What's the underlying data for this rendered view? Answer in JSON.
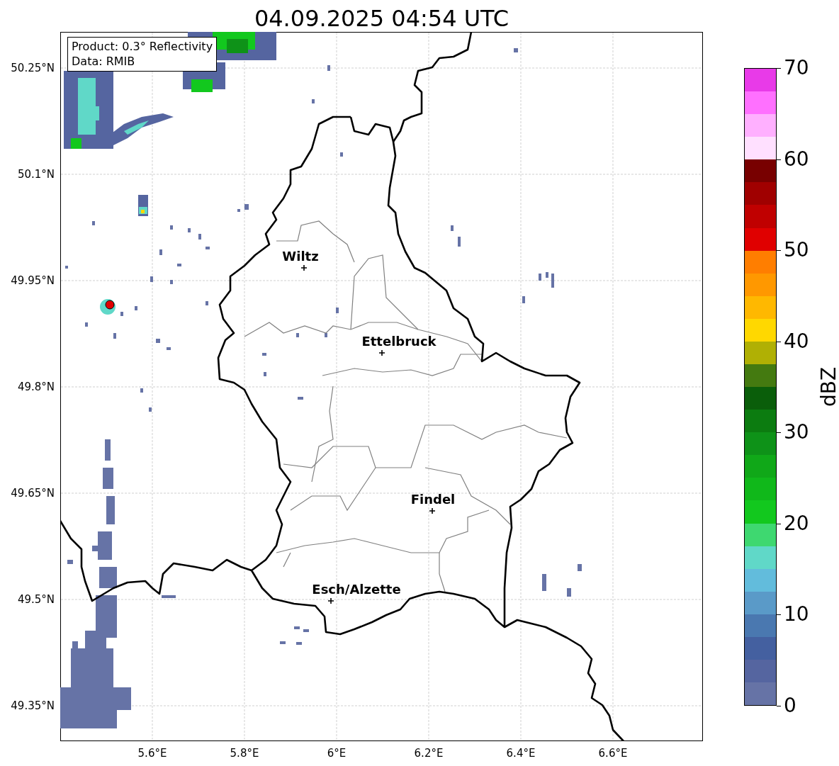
{
  "title": "04.09.2025 04:54 UTC",
  "info_box": {
    "lines": [
      "Product: 0.3° Reflectivity",
      "Data: RMIB"
    ]
  },
  "map": {
    "yticks": [
      "50.25°N",
      "50.1°N",
      "49.95°N",
      "49.8°N",
      "49.65°N",
      "49.5°N",
      "49.35°N"
    ],
    "xticks": [
      "5.6°E",
      "5.8°E",
      "6°E",
      "6.2°E",
      "6.4°E",
      "6.6°E"
    ],
    "cities": [
      {
        "name": "Wiltz"
      },
      {
        "name": "Ettelbruck"
      },
      {
        "name": "Findel"
      },
      {
        "name": "Esch/Alzette"
      }
    ]
  },
  "colorbar": {
    "label": "dBZ",
    "ticks": [
      "70",
      "60",
      "50",
      "40",
      "30",
      "20",
      "10",
      "0"
    ],
    "bins": [
      {
        "color": "#e83ae8"
      },
      {
        "color": "#ff70ff"
      },
      {
        "color": "#ffb0ff"
      },
      {
        "color": "#ffe0ff"
      },
      {
        "color": "#780000"
      },
      {
        "color": "#a00000"
      },
      {
        "color": "#c00000"
      },
      {
        "color": "#e00000"
      },
      {
        "color": "#ff7e00"
      },
      {
        "color": "#ff9800"
      },
      {
        "color": "#ffb800"
      },
      {
        "color": "#ffd800"
      },
      {
        "color": "#b0b004"
      },
      {
        "color": "#447a10"
      },
      {
        "color": "#0a5e0a"
      },
      {
        "color": "#0c7c10"
      },
      {
        "color": "#0e9218"
      },
      {
        "color": "#10a818"
      },
      {
        "color": "#10b81a"
      },
      {
        "color": "#12c81e"
      },
      {
        "color": "#3ed870"
      },
      {
        "color": "#60d8c8"
      },
      {
        "color": "#62bcdc"
      },
      {
        "color": "#5a9ac8"
      },
      {
        "color": "#4a78b0"
      },
      {
        "color": "#4460a0"
      },
      {
        "color": "#5565a0"
      },
      {
        "color": "#6673a6"
      }
    ]
  }
}
